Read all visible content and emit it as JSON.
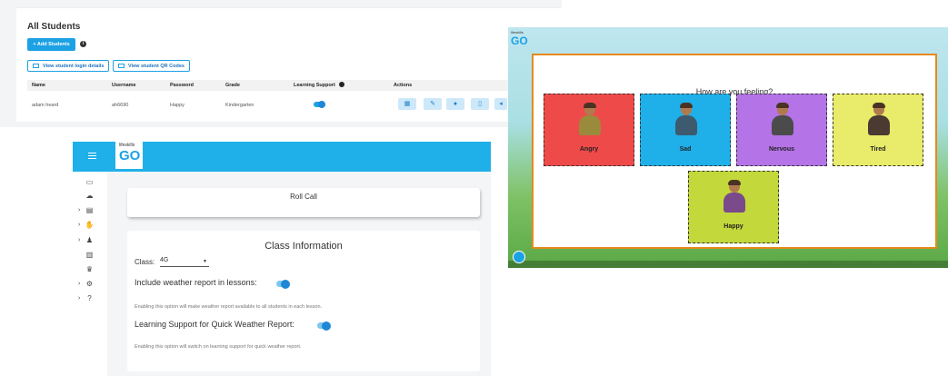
{
  "students": {
    "title": "All Students",
    "add_button": "+ Add Students",
    "info_icon": "i",
    "login_button": "View student login details",
    "qr_button": "View student QR Codes",
    "columns": [
      "Name",
      "Username",
      "Password",
      "Grade",
      "Learning Support",
      "Actions"
    ],
    "row": {
      "name": "adam heard",
      "username": "ah6690",
      "password": "Happy",
      "grade": "Kindergarten",
      "learning_support": true
    },
    "action_icons": [
      "grid-icon",
      "edit-icon",
      "user-icon",
      "trash-icon",
      "arrow-icon"
    ]
  },
  "roll_call": {
    "logo_small": "lifeskills",
    "logo_big": "GO",
    "heading": "Roll Call",
    "section_title": "Class Information",
    "class_label": "Class:",
    "class_value": "4G",
    "weather_label": "Include weather report in lessons:",
    "weather_hint": "Enabling this option will make weather report available to all students in each lesson.",
    "learning_label": "Learning Support for Quick Weather Report:",
    "learning_hint": "Enabling this option will switch on learning support for quick weather report.",
    "sidebar_icons": [
      "monitor-icon",
      "weather-icon",
      "presentation-icon",
      "hand-icon",
      "people-icon",
      "chart-icon",
      "trophy-icon",
      "settings-icon",
      "help-icon"
    ]
  },
  "feelings": {
    "logo_small": "lifeskills",
    "logo_big": "GO",
    "question": "How are you feeling?",
    "options": [
      {
        "label": "Angry",
        "color": "#ef4a4a",
        "body": "#9a8a3c"
      },
      {
        "label": "Sad",
        "color": "#1fb0ea",
        "body": "#3e5a6e"
      },
      {
        "label": "Nervous",
        "color": "#b473e6",
        "body": "#4b4b4b"
      },
      {
        "label": "Tired",
        "color": "#e9eb6a",
        "body": "#4a3a32"
      },
      {
        "label": "Happy",
        "color": "#c3d83a",
        "body": "#7a4a8a"
      }
    ]
  }
}
